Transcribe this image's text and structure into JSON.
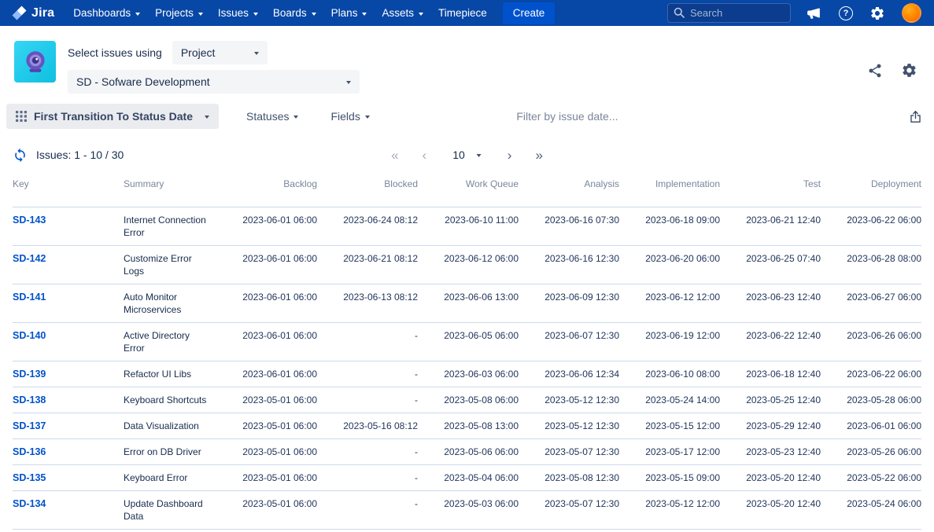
{
  "nav": {
    "brand": "Jira",
    "items": [
      {
        "label": "Dashboards",
        "chevron": true
      },
      {
        "label": "Projects",
        "chevron": true
      },
      {
        "label": "Issues",
        "chevron": true
      },
      {
        "label": "Boards",
        "chevron": true
      },
      {
        "label": "Plans",
        "chevron": true
      },
      {
        "label": "Assets",
        "chevron": true
      },
      {
        "label": "Timepiece",
        "chevron": false
      }
    ],
    "create_label": "Create",
    "search_placeholder": "Search"
  },
  "header": {
    "select_label": "Select issues using",
    "mode_value": "Project",
    "project_value": "SD - Sofware Development"
  },
  "toolbar": {
    "transition_label": "First Transition To Status Date",
    "statuses_label": "Statuses",
    "fields_label": "Fields",
    "filter_placeholder": "Filter by issue date..."
  },
  "pagination": {
    "issues_label": "Issues: 1 - 10 / 30",
    "page_size": "10",
    "first_glyph": "«",
    "prev_glyph": "‹",
    "next_glyph": "›",
    "last_glyph": "»"
  },
  "table": {
    "columns": [
      "Key",
      "Summary",
      "Backlog",
      "Blocked",
      "Work Queue",
      "Analysis",
      "Implementation",
      "Test",
      "Deployment"
    ],
    "rows": [
      {
        "key": "SD-143",
        "summary": "Internet Connection Error",
        "dates": [
          "2023-06-01 06:00",
          "2023-06-24 08:12",
          "2023-06-10 11:00",
          "2023-06-16 07:30",
          "2023-06-18 09:00",
          "2023-06-21 12:40",
          "2023-06-22 06:00"
        ]
      },
      {
        "key": "SD-142",
        "summary": "Customize Error Logs",
        "dates": [
          "2023-06-01 06:00",
          "2023-06-21 08:12",
          "2023-06-12 06:00",
          "2023-06-16 12:30",
          "2023-06-20 06:00",
          "2023-06-25 07:40",
          "2023-06-28 08:00"
        ]
      },
      {
        "key": "SD-141",
        "summary": "Auto Monitor Microservices",
        "dates": [
          "2023-06-01 06:00",
          "2023-06-13 08:12",
          "2023-06-06 13:00",
          "2023-06-09 12:30",
          "2023-06-12 12:00",
          "2023-06-23 12:40",
          "2023-06-27 06:00"
        ]
      },
      {
        "key": "SD-140",
        "summary": "Active Directory Error",
        "dates": [
          "2023-06-01 06:00",
          "-",
          "2023-06-05 06:00",
          "2023-06-07 12:30",
          "2023-06-19 12:00",
          "2023-06-22 12:40",
          "2023-06-26 06:00"
        ]
      },
      {
        "key": "SD-139",
        "summary": "Refactor UI Libs",
        "dates": [
          "2023-06-01 06:00",
          "-",
          "2023-06-03 06:00",
          "2023-06-06 12:34",
          "2023-06-10 08:00",
          "2023-06-18 12:40",
          "2023-06-22 06:00"
        ]
      },
      {
        "key": "SD-138",
        "summary": "Keyboard Shortcuts",
        "dates": [
          "2023-05-01 06:00",
          "-",
          "2023-05-08 06:00",
          "2023-05-12 12:30",
          "2023-05-24 14:00",
          "2023-05-25 12:40",
          "2023-05-28 06:00"
        ]
      },
      {
        "key": "SD-137",
        "summary": "Data Visualization",
        "dates": [
          "2023-05-01 06:00",
          "2023-05-16 08:12",
          "2023-05-08 13:00",
          "2023-05-12 12:30",
          "2023-05-15 12:00",
          "2023-05-29 12:40",
          "2023-06-01 06:00"
        ]
      },
      {
        "key": "SD-136",
        "summary": "Error on DB Driver",
        "dates": [
          "2023-05-01 06:00",
          "-",
          "2023-05-06 06:00",
          "2023-05-07 12:30",
          "2023-05-17 12:00",
          "2023-05-23 12:40",
          "2023-05-26 06:00"
        ]
      },
      {
        "key": "SD-135",
        "summary": "Keyboard Error",
        "dates": [
          "2023-05-01 06:00",
          "-",
          "2023-05-04 06:00",
          "2023-05-08 12:30",
          "2023-05-15 09:00",
          "2023-05-20 12:40",
          "2023-05-22 06:00"
        ]
      },
      {
        "key": "SD-134",
        "summary": "Update Dashboard Data",
        "dates": [
          "2023-05-01 06:00",
          "-",
          "2023-05-03 06:00",
          "2023-05-07 12:30",
          "2023-05-12 12:00",
          "2023-05-20 12:40",
          "2023-05-24 06:00"
        ]
      }
    ]
  },
  "icons": {
    "jira-logo": "stacked-diamonds",
    "search": "magnifier",
    "megaphone": "megaphone",
    "help_glyph": "?",
    "gear": "gear",
    "avatar": "orange-circle",
    "app-icon": "crystal-ball",
    "share": "share-nodes",
    "grid": "3x3-grid",
    "chevron": "triangle-down",
    "export": "tray-up-arrow",
    "refresh": "sync-arrows"
  },
  "colors": {
    "nav_bg": "#0747A6",
    "create_button": "#0052CC",
    "link": "#0052CC",
    "row_border": "#CDD9EE",
    "app_icon_bg": "#1EC8E7",
    "app_icon_fg": "#6554C0",
    "avatar": "#FF8B00",
    "muted_text": "#7A869A"
  }
}
